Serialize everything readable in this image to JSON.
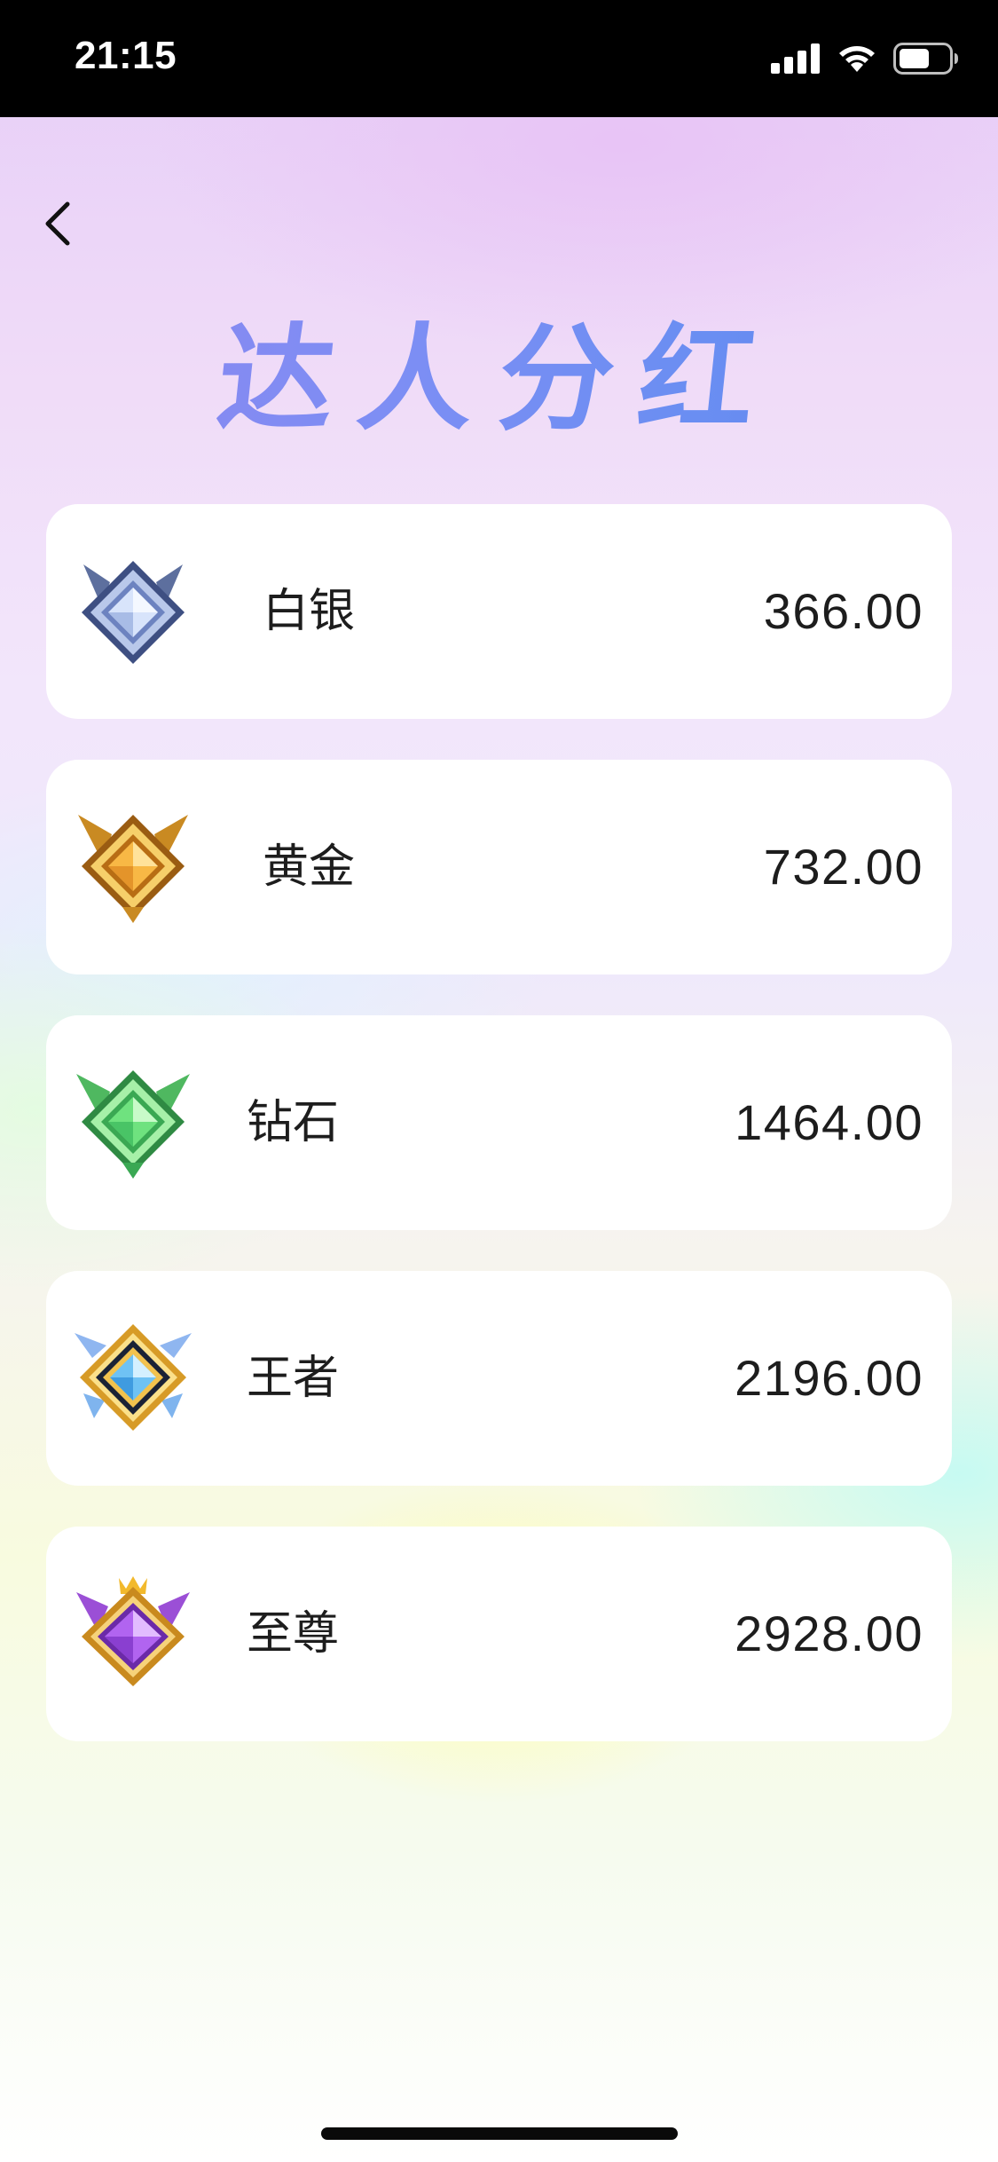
{
  "status_bar": {
    "time": "21:15",
    "icons": [
      "signal-icon",
      "wifi-icon",
      "battery-icon"
    ]
  },
  "header": {
    "back_icon": "chevron-left-icon",
    "title": "达人分红"
  },
  "tiers": [
    {
      "name": "白银",
      "amount": "366.00",
      "icon": "silver-rank-badge-icon",
      "color": "#8fa6d8"
    },
    {
      "name": "黄金",
      "amount": "732.00",
      "icon": "gold-rank-badge-icon",
      "color": "#e6a531"
    },
    {
      "name": "钻石",
      "amount": "1464.00",
      "icon": "diamond-rank-badge-icon",
      "color": "#4fcf6a"
    },
    {
      "name": "王者",
      "amount": "2196.00",
      "icon": "king-rank-badge-icon",
      "color": "#5ab8f0"
    },
    {
      "name": "至尊",
      "amount": "2928.00",
      "icon": "supreme-rank-badge-icon",
      "color": "#9a55e6"
    }
  ],
  "colors": {
    "title_gradient_start": "#8d86f0",
    "title_gradient_end": "#5e83ec",
    "card_background": "#ffffff",
    "text": "#1d1d1d"
  }
}
